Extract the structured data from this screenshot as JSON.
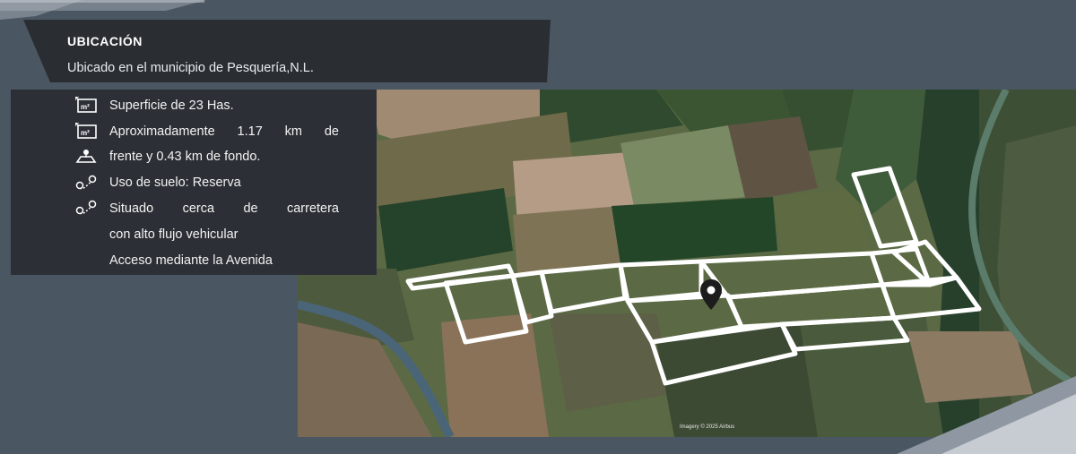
{
  "header": {
    "title": "UBICACIÓN",
    "subtitle": "Ubicado en el municipio de Pesquería,N.L."
  },
  "features": [
    {
      "icon": "area-m2-icon",
      "text": "Superficie de 23 Has."
    },
    {
      "icon": "area-m2-icon",
      "text_line1": "Aproximadamente 1.17 km de",
      "text_line2": "frente y 0.43 km de fondo."
    },
    {
      "icon": "land-plot-icon"
    },
    {
      "icon": "route-icon",
      "text": "Uso de suelo: Reserva"
    },
    {
      "icon": "route-icon",
      "text_line1": "Situado cerca de carretera",
      "text_line2": "con alto flujo vehicular",
      "text_line3": "Acceso mediante la Avenida"
    }
  ],
  "map": {
    "marker": "location-pin-icon",
    "credit": "Imagery © 2025 Airbus"
  },
  "colors": {
    "background": "#4b5663",
    "panel": "#2c3036",
    "outline": "#ffffff"
  }
}
